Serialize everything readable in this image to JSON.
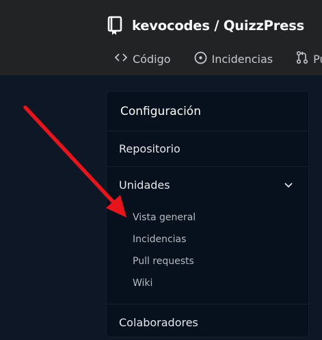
{
  "header": {
    "repo_title": "kevocodes / QuizzPress",
    "repo_icon": "repo-icon"
  },
  "tabs": [
    {
      "label": "Código",
      "icon": "code-icon"
    },
    {
      "label": "Incidencias",
      "icon": "issue-icon"
    },
    {
      "label": "Pu",
      "icon": "pull-request-icon"
    }
  ],
  "settings": {
    "title": "Configuración",
    "items": [
      {
        "label": "Repositorio"
      },
      {
        "label": "Unidades",
        "expanded": true,
        "children": [
          "Vista general",
          "Incidencias",
          "Pull requests",
          "Wiki"
        ]
      },
      {
        "label": "Colaboradores"
      }
    ]
  },
  "annotation": {
    "color": "#e8141c",
    "icon": "red-arrow-icon"
  },
  "colors": {
    "topbar": "#222325",
    "background": "#0d1726",
    "panel": "#07111d"
  }
}
